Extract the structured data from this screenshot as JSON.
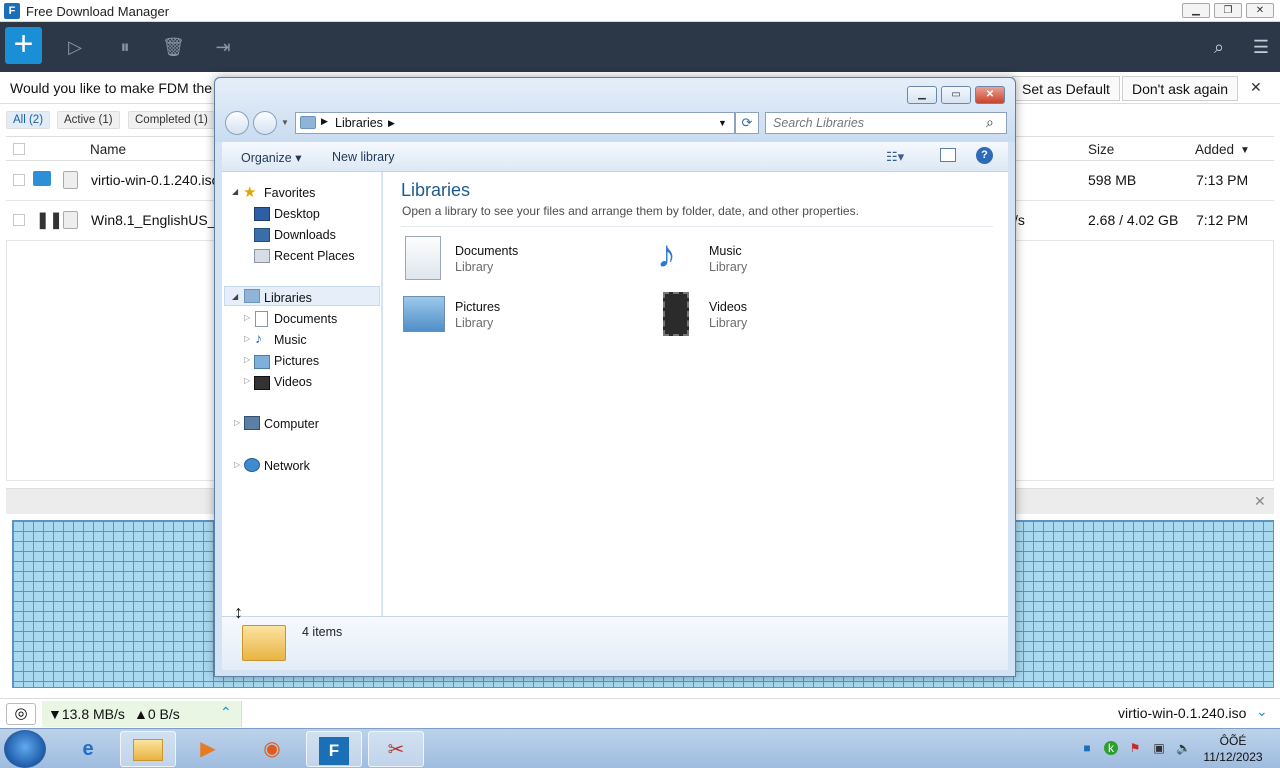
{
  "fdm": {
    "title": "Free Download Manager",
    "banner": {
      "message": "Would you like to make FDM the de",
      "set_default": "Set as Default",
      "dont_ask": "Don't ask again"
    },
    "tabs": [
      "All (2)",
      "Active (1)",
      "Completed (1)"
    ],
    "columns": {
      "name": "Name",
      "size": "Size",
      "added": "Added"
    },
    "downloads": [
      {
        "name": "virtio-win-0.1.240.iso",
        "size": "598 MB",
        "added": "7:13 PM",
        "speed": ""
      },
      {
        "name": "Win8.1_EnglishUS_",
        "size": "2.68 / 4.02 GB",
        "added": "7:12 PM",
        "speed": "/s"
      }
    ],
    "status": {
      "down": "▼13.8 MB/s",
      "up": "▲0 B/s",
      "current_file": "virtio-win-0.1.240.iso"
    }
  },
  "explorer": {
    "address": "Libraries",
    "search_placeholder": "Search Libraries",
    "organize": "Organize ▾",
    "new_library": "New library",
    "nav": {
      "favorites": "Favorites",
      "desktop": "Desktop",
      "downloads": "Downloads",
      "recent": "Recent Places",
      "libraries": "Libraries",
      "documents": "Documents",
      "music": "Music",
      "pictures": "Pictures",
      "videos": "Videos",
      "computer": "Computer",
      "network": "Network"
    },
    "heading": "Libraries",
    "subheading": "Open a library to see your files and arrange them by folder, date, and other properties.",
    "libraries": [
      {
        "name": "Documents",
        "type": "Library"
      },
      {
        "name": "Music",
        "type": "Library"
      },
      {
        "name": "Pictures",
        "type": "Library"
      },
      {
        "name": "Videos",
        "type": "Library"
      }
    ],
    "item_count": "4 items"
  },
  "taskbar": {
    "clock_time": "ÔÕÉ",
    "clock_date": "11/12/2023"
  },
  "colors": {
    "toolbar": "#2c3747",
    "accent": "#1a8fd6",
    "pieces": "#a9d9f0"
  }
}
